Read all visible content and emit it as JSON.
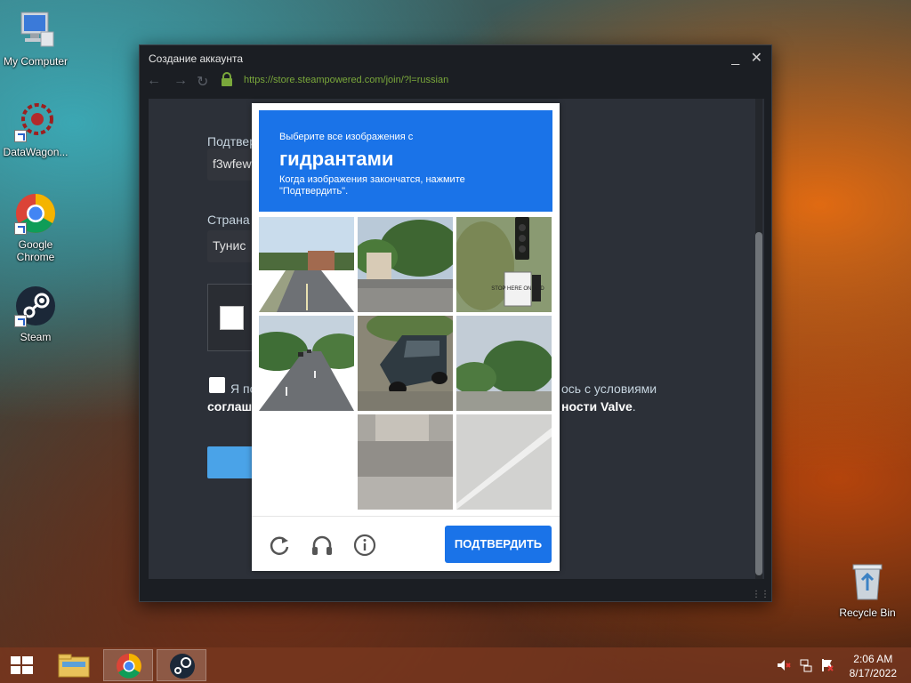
{
  "desktop": {
    "icons": [
      {
        "label": "My Computer"
      },
      {
        "label": "DataWagon..."
      },
      {
        "label": "Google Chrome"
      },
      {
        "label": "Steam"
      },
      {
        "label": "Recycle Bin"
      }
    ]
  },
  "window": {
    "title": "Создание аккаунта",
    "url": "https://store.steampowered.com/join/?l=russian",
    "controls": {
      "minimize": "_",
      "close": "✕"
    }
  },
  "form": {
    "confirm_label": "Подтвер",
    "confirm_value": "f3wfew",
    "country_label": "Страна",
    "country_value": "Тунис",
    "agree_prefix": "Я по",
    "agree_suffix": "ось с условиями",
    "agree_line2_prefix": "соглаше",
    "agree_line2_suffix": "ности Valve",
    "agree_period": "."
  },
  "captcha": {
    "line1": "Выберите все изображения с",
    "line2": "гидрантами",
    "line3": "Когда изображения закончатся, нажмите \"Подтвердить\".",
    "confirm_button": "ПОДТВЕРДИТЬ",
    "tiles": [
      {
        "name": "tile-road-houses"
      },
      {
        "name": "tile-street-trees"
      },
      {
        "name": "tile-traffic-light-stop-sign",
        "sign_text": "STOP HERE ON RED"
      },
      {
        "name": "tile-highway-cars"
      },
      {
        "name": "tile-parked-car"
      },
      {
        "name": "tile-trees-park"
      },
      {
        "name": "tile-blank"
      },
      {
        "name": "tile-sidewalk-house"
      },
      {
        "name": "tile-road-line"
      }
    ],
    "icons": [
      "refresh-icon",
      "headphones-icon",
      "info-icon"
    ]
  },
  "taskbar": {
    "time": "2:06 AM",
    "date": "8/17/2022"
  },
  "colors": {
    "captcha_blue": "#1a73e8",
    "url_green": "#7aa83b"
  }
}
